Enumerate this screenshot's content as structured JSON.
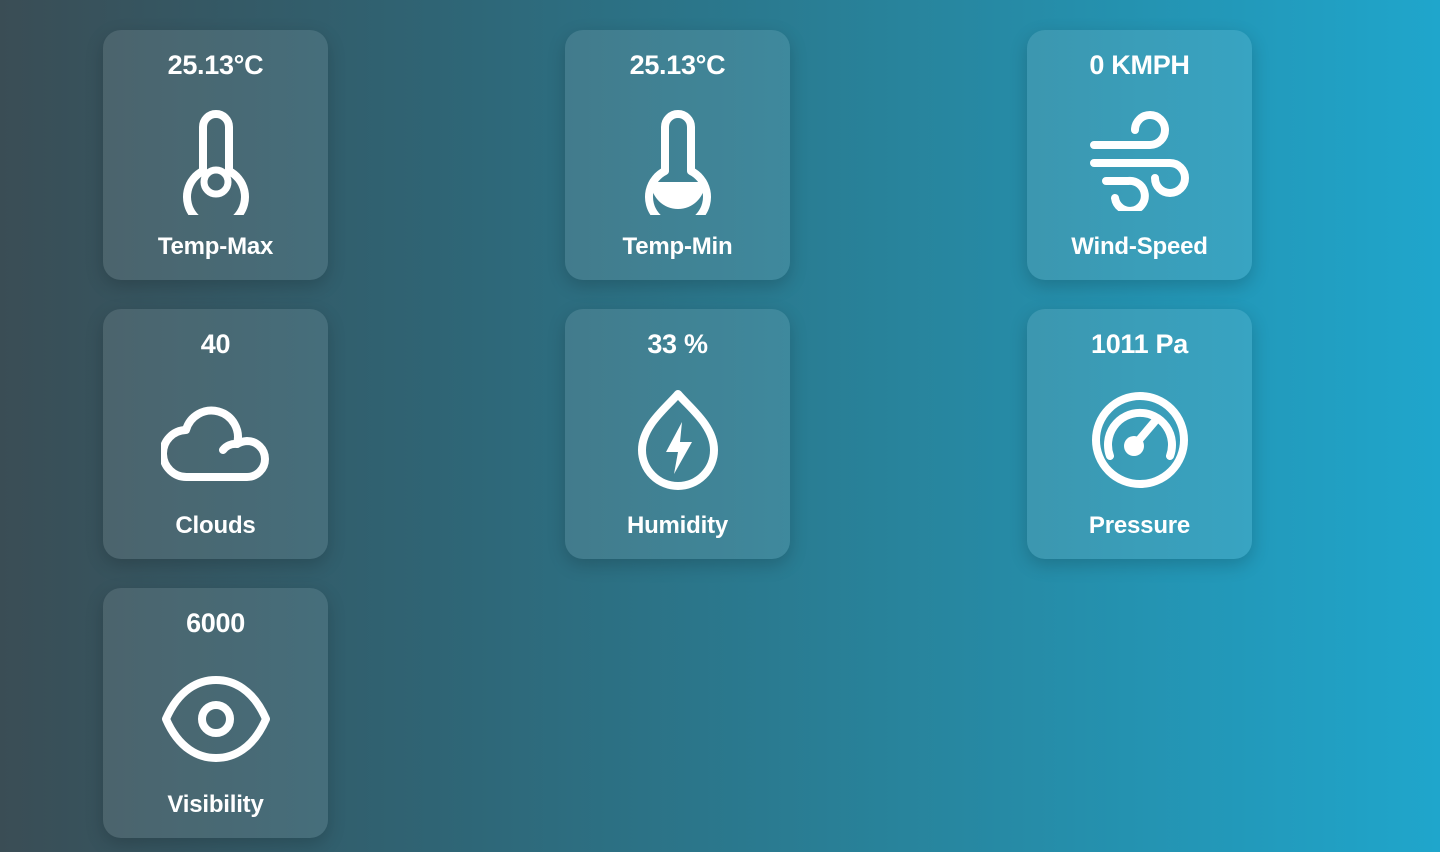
{
  "colors": {
    "background_left": "#3a4d55",
    "background_right": "#1fa6cc",
    "text": "#ffffff"
  },
  "cards": [
    {
      "value": "25.13°C",
      "label": "Temp-Max",
      "icon": "thermometer-high-icon"
    },
    {
      "value": "25.13°C",
      "label": "Temp-Min",
      "icon": "thermometer-low-icon"
    },
    {
      "value": "0 KMPH",
      "label": "Wind-Speed",
      "icon": "wind-icon"
    },
    {
      "value": "40",
      "label": "Clouds",
      "icon": "cloud-icon"
    },
    {
      "value": "33 %",
      "label": "Humidity",
      "icon": "droplet-bolt-icon"
    },
    {
      "value": "1011 Pa",
      "label": "Pressure",
      "icon": "gauge-icon"
    },
    {
      "value": "6000",
      "label": "Visibility",
      "icon": "eye-icon"
    }
  ]
}
